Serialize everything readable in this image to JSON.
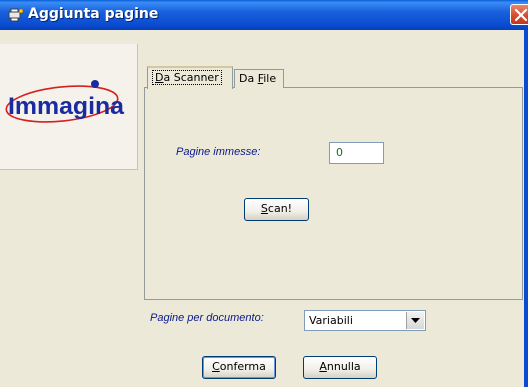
{
  "window": {
    "title": "Aggiunta pagine",
    "icon": "printer-scanner-icon",
    "close_icon": "close-icon"
  },
  "logo": {
    "text": "Immagina",
    "icon": "immagina-logo"
  },
  "tabs": [
    {
      "label_prefix": "",
      "label_accel": "D",
      "label_rest": "a Scanner",
      "active": true
    },
    {
      "label_prefix": "Da ",
      "label_accel": "F",
      "label_rest": "ile",
      "active": false
    }
  ],
  "scanner": {
    "pages_label": "Pagine immesse:",
    "pages_value": "0",
    "scan_accel": "S",
    "scan_rest": "can!"
  },
  "pages_per_doc": {
    "label": "Pagine per documento:",
    "selected": "Variabili"
  },
  "buttons": {
    "confirm_accel": "C",
    "confirm_rest": "onferma",
    "cancel_accel": "A",
    "cancel_rest": "nnulla"
  },
  "colors": {
    "titlebar": "#0a4bd0",
    "label_blue": "#0a1a8c",
    "value_green": "#1a6a1a",
    "logo_red": "#d42020"
  }
}
